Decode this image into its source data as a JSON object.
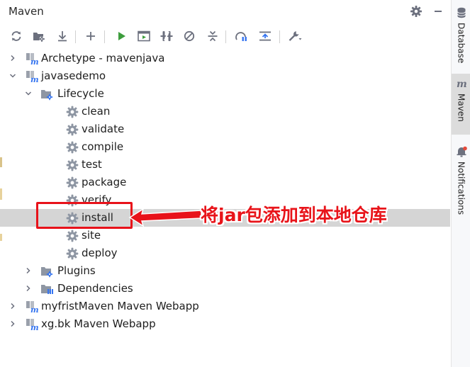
{
  "panel": {
    "title": "Maven",
    "title_icons": [
      "gear-icon",
      "minimize-icon"
    ]
  },
  "toolbar": {
    "buttons": [
      {
        "name": "reload-icon",
        "tooltip": "Reload All Maven Projects"
      },
      {
        "name": "generate-sources-icon",
        "tooltip": "Generate Sources"
      },
      {
        "name": "download-icon",
        "tooltip": "Download Sources"
      },
      {
        "name": "add-icon",
        "tooltip": "Add Maven Projects"
      },
      {
        "name": "run-icon",
        "tooltip": "Run Maven Build"
      },
      {
        "name": "execute-goal-icon",
        "tooltip": "Execute Maven Goal"
      },
      {
        "name": "toggle-offline-icon",
        "tooltip": "Toggle Offline Mode"
      },
      {
        "name": "skip-tests-icon",
        "tooltip": "Skip Tests"
      },
      {
        "name": "collapse-all-icon",
        "tooltip": "Collapse All"
      },
      {
        "name": "show-dependencies-icon",
        "tooltip": "Show Dependencies"
      },
      {
        "name": "expand-icon",
        "tooltip": "Expand"
      },
      {
        "name": "settings-wrench-icon",
        "tooltip": "Maven Settings"
      }
    ],
    "accent_run": "#3d9d3d",
    "accent_blue": "#3574f0"
  },
  "tree": [
    {
      "label": "Archetype - mavenjava",
      "type": "project",
      "state": "collapsed"
    },
    {
      "label": "javasedemo",
      "type": "project",
      "state": "expanded"
    },
    {
      "label": "Lifecycle",
      "type": "folder",
      "state": "expanded"
    },
    {
      "label": "clean",
      "type": "goal"
    },
    {
      "label": "validate",
      "type": "goal"
    },
    {
      "label": "compile",
      "type": "goal"
    },
    {
      "label": "test",
      "type": "goal"
    },
    {
      "label": "package",
      "type": "goal"
    },
    {
      "label": "verify",
      "type": "goal"
    },
    {
      "label": "install",
      "type": "goal",
      "selected": true
    },
    {
      "label": "site",
      "type": "goal"
    },
    {
      "label": "deploy",
      "type": "goal"
    },
    {
      "label": "Plugins",
      "type": "folder",
      "state": "collapsed"
    },
    {
      "label": "Dependencies",
      "type": "deps",
      "state": "collapsed"
    },
    {
      "label": "myfristMaven Maven Webapp",
      "type": "project",
      "state": "collapsed"
    },
    {
      "label": "xg.bk Maven Webapp",
      "type": "project",
      "state": "collapsed"
    }
  ],
  "sidebar": {
    "tabs": [
      {
        "label": "Database",
        "icon": "database-icon"
      },
      {
        "label": "Maven",
        "icon": "maven-icon",
        "active": true
      },
      {
        "label": "Notifications",
        "icon": "bell-icon"
      }
    ]
  },
  "annotation": {
    "text": "将jar包添加到本地仓库",
    "color": "#e8121a"
  }
}
